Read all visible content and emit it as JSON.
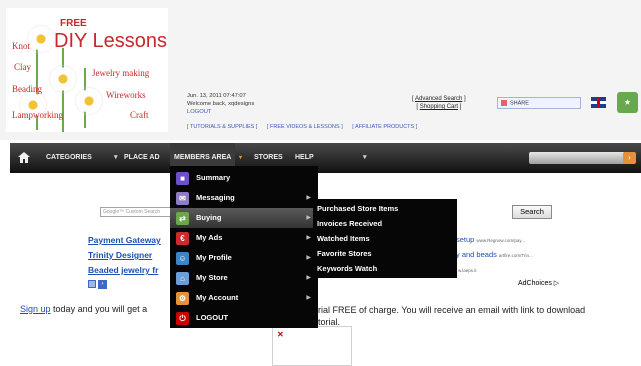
{
  "logo": {
    "free": "FREE",
    "title": "DIY Lessons",
    "crafts": [
      "Knot",
      "Clay",
      "Jewelry making",
      "Beading",
      "Wireworks",
      "Craft",
      "Lampworking"
    ]
  },
  "welcome": {
    "datetime": "Jun. 13, 2011 07:47:07",
    "greeting": "Welcome back, xqdesigns",
    "logout": "LOGOUT"
  },
  "toplinks": [
    "[ TUTORIALS & SUPPLIES ]",
    "[ FREE VIDEOS & LESSONS ]",
    "[ AFFILIATE PRODUCTS ]"
  ],
  "header_links": {
    "advanced_search": "Advanced Search",
    "shopping_cart": "Shopping Cart",
    "share": "SHARE"
  },
  "nav": {
    "categories": "CATEGORIES",
    "place_ad": "PLACE AD",
    "members_area": "MEMBERS AREA",
    "stores": "STORES",
    "help": "HELP"
  },
  "search": {
    "placeholder": "Google™ Custom Search",
    "button": "Search"
  },
  "ads": {
    "left": [
      "Payment Gateway",
      "Trinity Designer",
      "Beaded jewelry fr"
    ],
    "right": [
      {
        "text": "setup",
        "url": "www.Regnow.com/pay..."
      },
      {
        "text": "y and beads",
        "url": "artfire.com/Trin..."
      },
      {
        "text": "",
        "url": "w.laeps.it"
      }
    ],
    "adchoices": "AdChoices ▷"
  },
  "signup": {
    "link": "Sign up",
    "text_left": "today and you will get a",
    "text_right_1": "orial FREE of charge. You will receive an email with link to download",
    "text_right_2": "utorial."
  },
  "menu": {
    "items": [
      {
        "label": "Summary",
        "color": "#6d4fc9",
        "icon": "summary-icon"
      },
      {
        "label": "Messaging",
        "color": "#8e7cc3",
        "icon": "messaging-icon"
      },
      {
        "label": "Buying",
        "color": "#6aa84f",
        "icon": "buying-icon"
      },
      {
        "label": "My Ads",
        "color": "#cc2b2b",
        "icon": "my-ads-icon"
      },
      {
        "label": "My Profile",
        "color": "#3d85c6",
        "icon": "my-profile-icon"
      },
      {
        "label": "My Store",
        "color": "#6a9ed6",
        "icon": "my-store-icon"
      },
      {
        "label": "My Account",
        "color": "#e69138",
        "icon": "my-account-icon"
      },
      {
        "label": "LOGOUT",
        "color": "#cc0000",
        "icon": "logout-icon"
      }
    ],
    "buying_submenu": [
      "Purchased Store Items",
      "Invoices Received",
      "Watched Items",
      "Favorite Stores",
      "Keywords Watch"
    ]
  }
}
